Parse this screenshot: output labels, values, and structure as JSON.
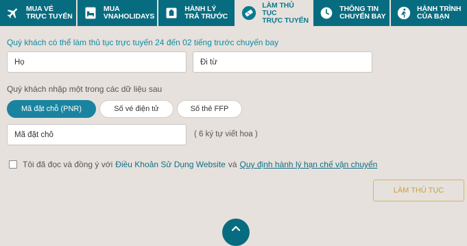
{
  "tabs": [
    {
      "line1": "MUA VÉ",
      "line2": "TRỰC TUYẾN",
      "icon": "plane-icon"
    },
    {
      "line1": "MUA",
      "line2": "VNAHOLIDAYS",
      "icon": "hotel-bed-icon"
    },
    {
      "line1": "HÀNH LÝ",
      "line2": "TRẢ TRƯỚC",
      "icon": "luggage-icon"
    },
    {
      "line1": "LÀM THỦ TỤC",
      "line2": "TRỰC TUYẾN",
      "icon": "ticket-icon",
      "active": true
    },
    {
      "line1": "THÔNG TIN",
      "line2": "CHUYẾN BAY",
      "icon": "clock-icon"
    },
    {
      "line1": "HÀNH TRÌNH",
      "line2": "CỦA BẠN",
      "icon": "traveler-icon"
    }
  ],
  "form": {
    "intro": "Quý khách có thể làm thủ tục trực tuyến 24 đến 02 tiếng trước chuyến bay",
    "last_name_placeholder": "Họ",
    "from_placeholder": "Đi từ",
    "section_label": "Quý khách nhập một trong các dữ liệu sau",
    "options": [
      "Mã đặt chỗ (PNR)",
      "Số vé điện tử",
      "Số thẻ FFP"
    ],
    "booking_code_placeholder": "Mã đặt chỗ",
    "booking_code_hint": "( 6 ký tự viết hoa )",
    "terms_prefix": "Tôi đã đọc và đồng ý với",
    "terms_link": "Điều Khoản Sử Dụng Website",
    "terms_and": "và",
    "baggage_link": "Quy định hành lý hạn chế vận chuyển",
    "submit_label": "LÀM THỦ TỤC"
  },
  "colors": {
    "brand": "#086c80",
    "accent": "#d9b45f",
    "background": "#e6e1dc"
  }
}
